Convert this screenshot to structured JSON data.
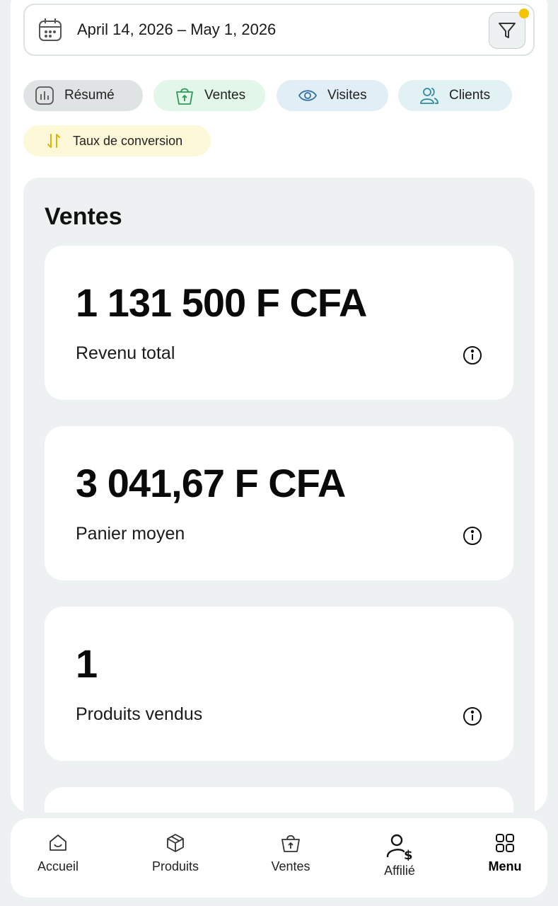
{
  "date_range": {
    "text": "April 14, 2026 – May 1, 2026"
  },
  "filters": {
    "chips": [
      {
        "label": "Résumé",
        "icon": "bar-chart-icon"
      },
      {
        "label": "Ventes",
        "icon": "shopping-bag-icon"
      },
      {
        "label": "Visites",
        "icon": "eye-icon"
      },
      {
        "label": "Clients",
        "icon": "users-icon"
      },
      {
        "label": "Taux de conversion",
        "icon": "conversion-arrows-icon"
      }
    ]
  },
  "section": {
    "title": "Ventes",
    "stats": [
      {
        "value": "1 131 500 F CFA",
        "label": "Revenu total"
      },
      {
        "value": "3 041,67 F CFA",
        "label": "Panier moyen"
      },
      {
        "value": "1",
        "label": "Produits vendus"
      }
    ]
  },
  "bottom_nav": {
    "items": [
      {
        "label": "Accueil",
        "icon": "home-icon"
      },
      {
        "label": "Produits",
        "icon": "box-icon"
      },
      {
        "label": "Ventes",
        "icon": "shopping-bag-icon"
      },
      {
        "label": "Affilié",
        "icon": "affiliate-icon"
      },
      {
        "label": "Menu",
        "icon": "grid-icon"
      }
    ]
  },
  "colors": {
    "accent_yellow": "#f4c400",
    "ventes_chip": "#e3f6ea",
    "visites_chip": "#e2eef6",
    "clients_chip": "#e2f1f3",
    "taux_chip": "#fdf8d8",
    "resume_chip": "#dfe3e4"
  }
}
